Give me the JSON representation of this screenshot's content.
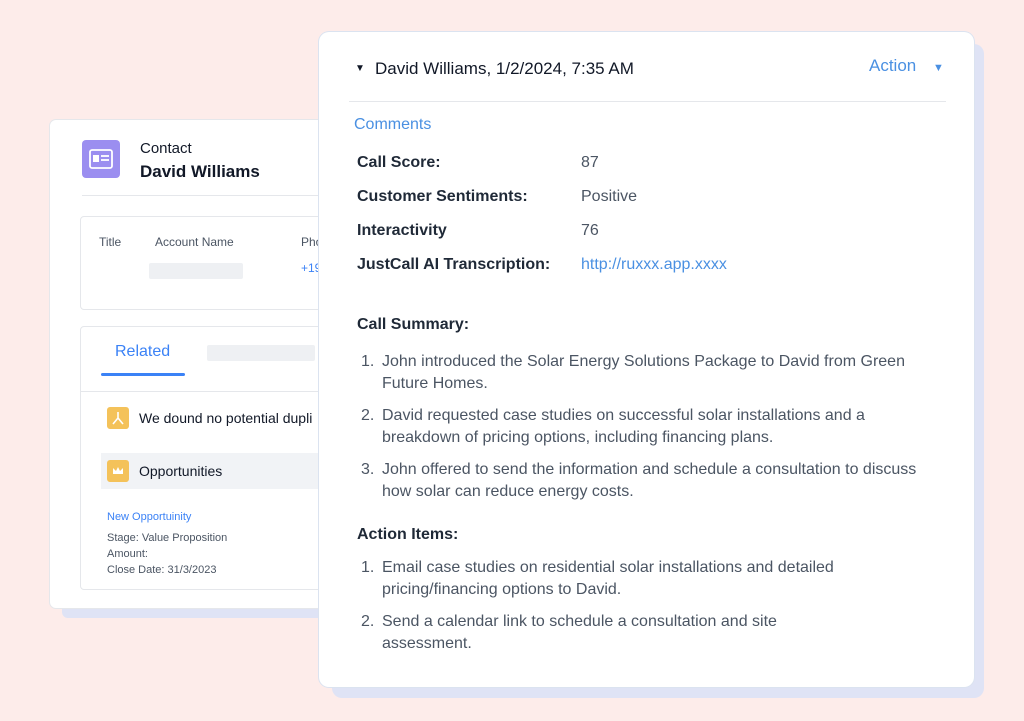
{
  "contact": {
    "kind": "Contact",
    "name": "David Williams",
    "fields": {
      "title_label": "Title",
      "account_name_label": "Account Name",
      "phone_label": "Pho",
      "phone_value": "+19"
    },
    "related": {
      "tab_label": "Related",
      "duplicates_text": "We dound no potential dupli",
      "opportunities_label": "Opportunities",
      "new_opportunity_link": "New Opportuinity",
      "stage": "Stage: Value Proposition",
      "amount": "Amount:",
      "close_date": "Close Date: 31/3/2023"
    }
  },
  "call": {
    "header_title": "David Williams, 1/2/2024, 7:35 AM",
    "action_label": "Action",
    "comments_label": "Comments",
    "metrics": [
      {
        "label": "Call Score:",
        "value": "87"
      },
      {
        "label": "Customer Sentiments:",
        "value": "Positive"
      },
      {
        "label": "Interactivity",
        "value": "76"
      },
      {
        "label": "JustCall AI Transcription:",
        "value": "http://ruxxx.app.xxxx"
      }
    ],
    "summary_title": "Call Summary:",
    "summary_items": [
      {
        "num": "1.",
        "text": "John introduced the Solar Energy Solutions Package to David from Green Future Homes."
      },
      {
        "num": "2.",
        "text": "David requested case studies on successful solar installations and a breakdown of pricing options, including financing plans."
      },
      {
        "num": "3.",
        "text": "John offered to send the information and schedule a consultation to discuss how solar can reduce energy costs."
      }
    ],
    "action_items_title": "Action Items:",
    "action_items": [
      {
        "num": "1.",
        "text": "Email case studies on residential solar installations and detailed pricing/financing options to David."
      },
      {
        "num": "2.",
        "text": "Send a calendar link to schedule a consultation and site assessment."
      }
    ]
  },
  "colors": {
    "accent": "#4a90e2",
    "contact_icon_bg": "#9b8ef0",
    "related_icon_bg": "#f4c25a",
    "background": "#fdecea"
  },
  "icons": {
    "contact": "contact-card-icon",
    "duplicates": "merge-icon",
    "opportunities": "crown-icon",
    "collapse": "caret-down-icon",
    "action_dropdown": "chevron-down-icon"
  }
}
